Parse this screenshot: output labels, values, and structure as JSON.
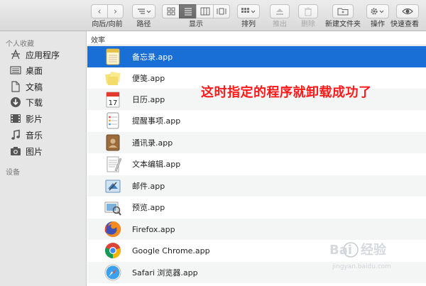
{
  "toolbar": {
    "nav_label": "向后/向前",
    "path_label": "路径",
    "view_label": "显示",
    "arrange_label": "排列",
    "eject_label": "推出",
    "delete_label": "删除",
    "newfolder_label": "新建文件夹",
    "action_label": "操作",
    "quicklook_label": "快速查看"
  },
  "sidebar": {
    "favorites_heading": "个人收藏",
    "devices_heading": "设备",
    "items": [
      {
        "label": "应用程序",
        "icon": "applications-icon"
      },
      {
        "label": "桌面",
        "icon": "desktop-icon"
      },
      {
        "label": "文稿",
        "icon": "documents-icon"
      },
      {
        "label": "下载",
        "icon": "downloads-icon"
      },
      {
        "label": "影片",
        "icon": "movies-icon"
      },
      {
        "label": "音乐",
        "icon": "music-icon"
      },
      {
        "label": "图片",
        "icon": "pictures-icon"
      }
    ]
  },
  "list": {
    "group_header": "效率",
    "files": [
      {
        "name": "备忘录.app",
        "icon": "notes-app-icon"
      },
      {
        "name": "便笺.app",
        "icon": "stickies-app-icon"
      },
      {
        "name": "日历.app",
        "icon": "calendar-app-icon"
      },
      {
        "name": "提醒事项.app",
        "icon": "reminders-app-icon"
      },
      {
        "name": "通讯录.app",
        "icon": "contacts-app-icon"
      },
      {
        "name": "文本编辑.app",
        "icon": "textedit-app-icon"
      },
      {
        "name": "邮件.app",
        "icon": "mail-app-icon"
      },
      {
        "name": "预览.app",
        "icon": "preview-app-icon"
      },
      {
        "name": "Firefox.app",
        "icon": "firefox-app-icon"
      },
      {
        "name": "Google Chrome.app",
        "icon": "chrome-app-icon"
      },
      {
        "name": "Safari 浏览器.app",
        "icon": "safari-app-icon"
      }
    ],
    "selected_index": 0
  },
  "annotation": "这时指定的程序就卸载成功了",
  "calendar_day": "17",
  "watermark": "Baidu 经验",
  "colors": {
    "selection": "#1a6fd6",
    "annotation": "#ff1a1a"
  }
}
